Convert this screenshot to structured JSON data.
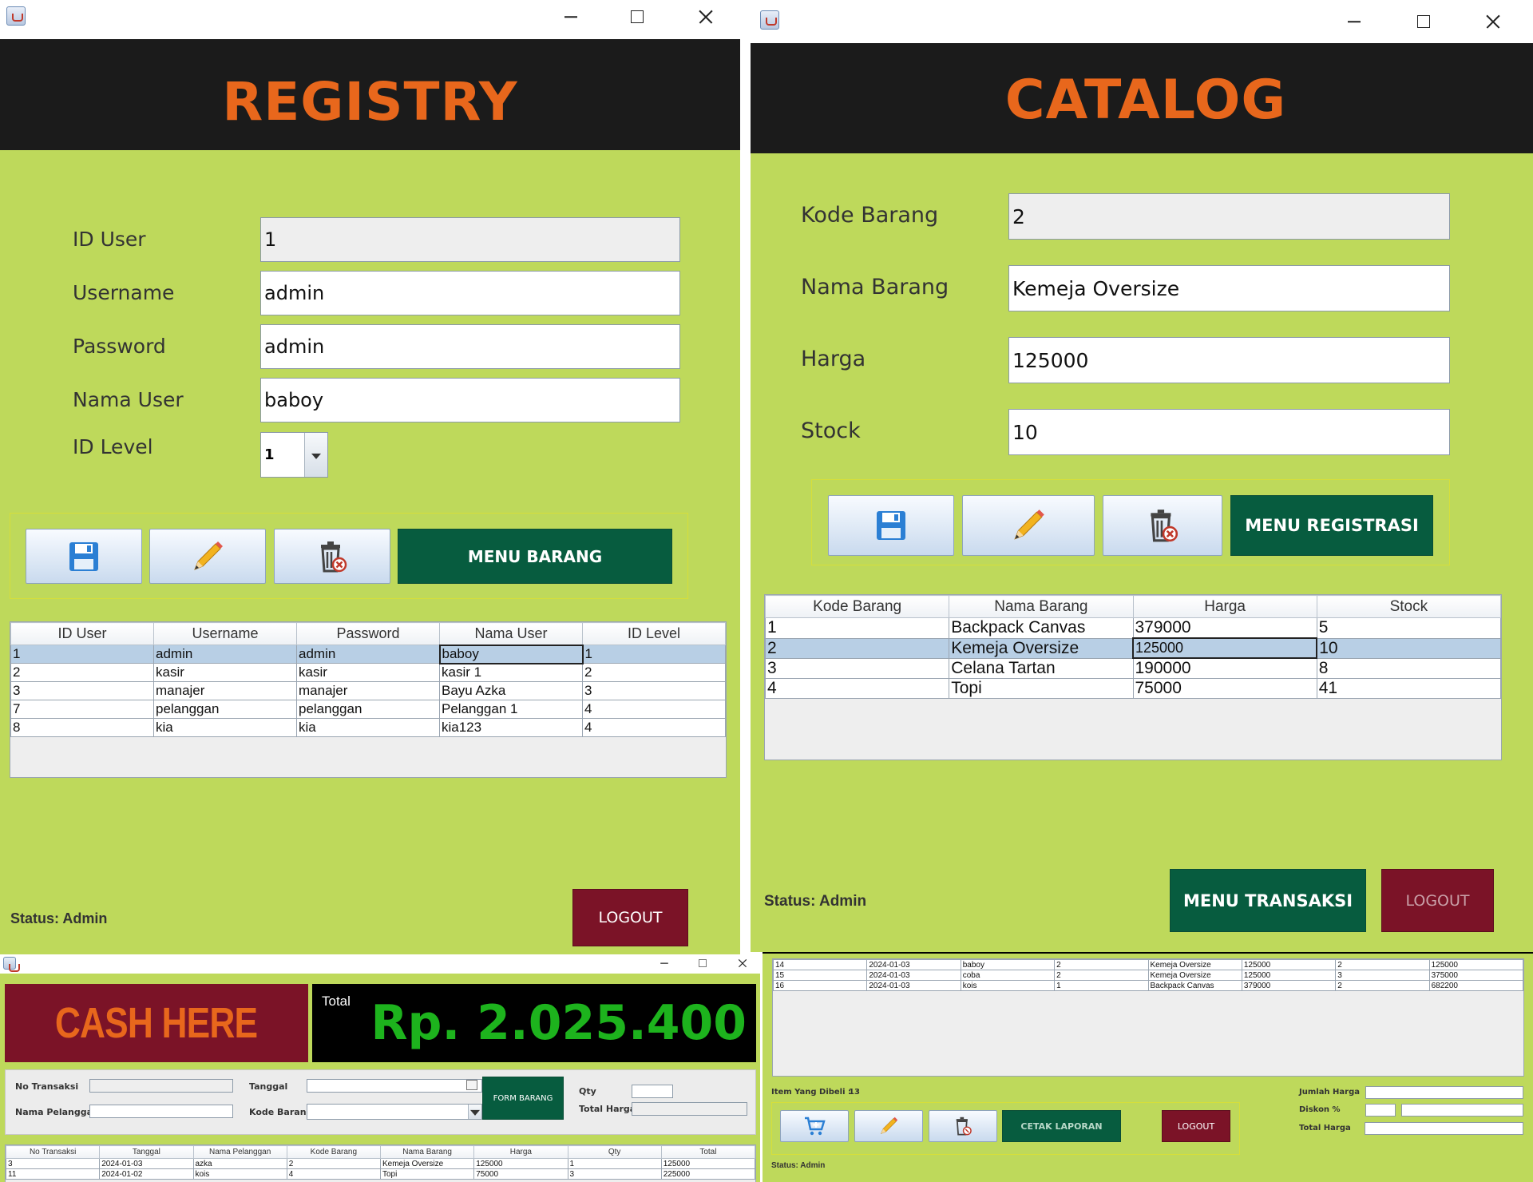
{
  "registry": {
    "title": "REGISTRY",
    "labels": {
      "id_user": "ID User",
      "username": "Username",
      "password": "Password",
      "nama_user": "Nama User",
      "id_level": "ID Level"
    },
    "values": {
      "id_user": "1",
      "username": "admin",
      "password": "admin",
      "nama_user": "baboy",
      "id_level": "1"
    },
    "menu_button": "MENU BARANG",
    "table": {
      "columns": [
        "ID User",
        "Username",
        "Password",
        "Nama User",
        "ID Level"
      ],
      "rows": [
        [
          "1",
          "admin",
          "admin",
          "baboy",
          "1"
        ],
        [
          "2",
          "kasir",
          "kasir",
          "kasir 1",
          "2"
        ],
        [
          "3",
          "manajer",
          "manajer",
          "Bayu Azka",
          "3"
        ],
        [
          "7",
          "pelanggan",
          "pelanggan",
          "Pelanggan 1",
          "4"
        ],
        [
          "8",
          "kia",
          "kia",
          "kia123",
          "4"
        ]
      ],
      "selected_row": 0
    },
    "status": "Status: Admin",
    "logout": "LOGOUT"
  },
  "catalog": {
    "title": "CATALOG",
    "labels": {
      "kode_barang": "Kode Barang",
      "nama_barang": "Nama Barang",
      "harga": "Harga",
      "stock": "Stock"
    },
    "values": {
      "kode_barang": "2",
      "nama_barang": "Kemeja Oversize",
      "harga": "125000",
      "stock": "10"
    },
    "menu_button": "MENU REGISTRASI",
    "table": {
      "columns": [
        "Kode Barang",
        "Nama Barang",
        "Harga",
        "Stock"
      ],
      "rows": [
        [
          "1",
          "Backpack Canvas",
          "379000",
          "5"
        ],
        [
          "2",
          "Kemeja Oversize",
          "125000",
          "10"
        ],
        [
          "3",
          "Celana Tartan",
          "190000",
          "8"
        ],
        [
          "4",
          "Topi",
          "75000",
          "41"
        ]
      ],
      "selected_row": 1
    },
    "status": "Status: Admin",
    "menu_transaksi": "MENU TRANSAKSI",
    "logout": "LOGOUT"
  },
  "cashier": {
    "banner": "CASH HERE",
    "total_label": "Total",
    "total_value": "Rp. 2.025.400",
    "labels": {
      "no_transaksi": "No Transaksi",
      "nama_pelanggan": "Nama Pelanggan",
      "tanggal": "Tanggal",
      "kode_barang": "Kode Barang",
      "qty": "Qty",
      "total_harga": "Total Harga"
    },
    "form_barang": "FORM BARANG",
    "table": {
      "columns": [
        "No Transaksi",
        "Tanggal",
        "Nama Pelanggan",
        "Kode Barang",
        "Nama Barang",
        "Harga",
        "Qty",
        "Total"
      ],
      "rows": [
        [
          "3",
          "2024-01-03",
          "azka",
          "2",
          "Kemeja Oversize",
          "125000",
          "1",
          "125000"
        ],
        [
          "11",
          "2024-01-02",
          "kois",
          "4",
          "Topi",
          "75000",
          "3",
          "225000"
        ]
      ]
    }
  },
  "transaction": {
    "table": {
      "rows": [
        [
          "14",
          "2024-01-03",
          "baboy",
          "2",
          "Kemeja Oversize",
          "125000",
          "2",
          "125000"
        ],
        [
          "15",
          "2024-01-03",
          "coba",
          "2",
          "Kemeja Oversize",
          "125000",
          "3",
          "375000"
        ],
        [
          "16",
          "2024-01-03",
          "kois",
          "1",
          "Backpack Canvas",
          "379000",
          "2",
          "682200"
        ]
      ]
    },
    "item_label": "Item Yang Dibeli :",
    "item_count": "13",
    "labels": {
      "jumlah_harga": "Jumlah Harga",
      "diskon": "Diskon %",
      "total_harga": "Total Harga"
    },
    "cetak_laporan": "CETAK LAPORAN",
    "logout": "LOGOUT",
    "status": "Status: Admin"
  },
  "colors": {
    "green_bg": "#bed95b",
    "header_bg": "#1b1b1b",
    "title_orange": "#e8671c",
    "dark_green_button": "#075c3f",
    "maroon_button": "#7b1327",
    "total_green": "#1db31d"
  }
}
